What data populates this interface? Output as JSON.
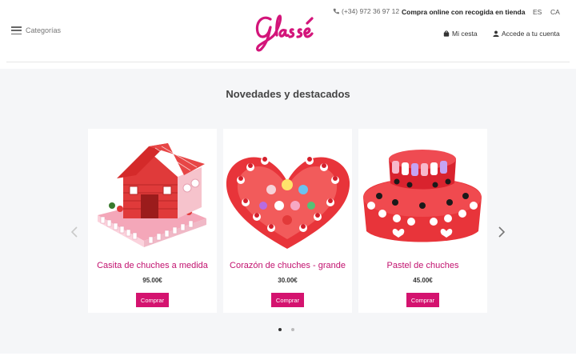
{
  "header": {
    "menu_label": "Categorías",
    "logo_text": "Glassé",
    "phone": "(+34) 972 36 97 12",
    "tagline": "Compra online con recogida en tienda",
    "languages": [
      "ES",
      "CA"
    ],
    "cart_label": "Mi cesta",
    "account_label": "Accede a tu cuenta"
  },
  "section": {
    "title": "Novedades y destacados"
  },
  "products": [
    {
      "name": "Casita de chuches a medida",
      "price": "95.00€",
      "button": "Comprar"
    },
    {
      "name": "Corazón de chuches - grande",
      "price": "30.00€",
      "button": "Comprar"
    },
    {
      "name": "Pastel de chuches",
      "price": "45.00€",
      "button": "Comprar"
    }
  ],
  "carousel": {
    "page_count": 2,
    "active_page": 1
  },
  "colors": {
    "accent": "#d4136f",
    "logo": "#d3157a",
    "section_bg": "#f5f6f8"
  }
}
